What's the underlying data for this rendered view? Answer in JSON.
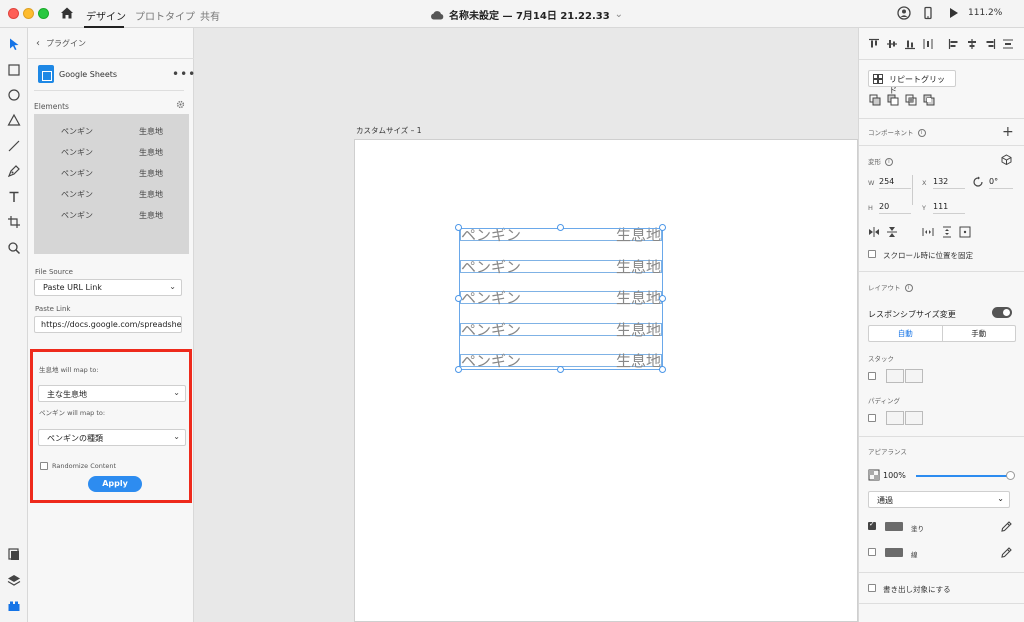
{
  "titlebar": {
    "tabs": [
      {
        "label": "デザイン"
      },
      {
        "label": "プロトタイプ"
      },
      {
        "label": "共有"
      }
    ],
    "document_title": "名称未設定 — 7月14日 21.22.33",
    "zoom": "111.2%"
  },
  "plugin": {
    "back_label": "プラグイン",
    "name": "Google Sheets",
    "elements_label": "Elements",
    "element_rows": [
      {
        "a": "ペンギン",
        "b": "生息地"
      },
      {
        "a": "ペンギン",
        "b": "生息地"
      },
      {
        "a": "ペンギン",
        "b": "生息地"
      },
      {
        "a": "ペンギン",
        "b": "生息地"
      },
      {
        "a": "ペンギン",
        "b": "生息地"
      }
    ],
    "file_source_label": "File Source",
    "file_source_value": "Paste URL Link",
    "paste_link_label": "Paste Link",
    "paste_link_value": "https://docs.google.com/spreadshe",
    "mapping": {
      "map1_label": "生息地 will map to:",
      "map1_value": "主な生息地",
      "map2_label": "ペンギン will map to:",
      "map2_value": "ペンギンの種類",
      "randomize_label": "Randomize Content",
      "apply_label": "Apply"
    }
  },
  "canvas": {
    "artboard_name": "カスタムサイズ – 1",
    "rows": [
      {
        "left": "ペンギン",
        "right": "生息地"
      },
      {
        "left": "ペンギン",
        "right": "生息地"
      },
      {
        "left": "ペンギン",
        "right": "生息地"
      },
      {
        "left": "ペンギン",
        "right": "生息地"
      },
      {
        "left": "ペンギン",
        "right": "生息地"
      }
    ]
  },
  "props": {
    "repeat_grid_label": "リピートグリッド",
    "component_label": "コンポーネント",
    "transform_label": "変形",
    "w_key": "W",
    "w_value": "254",
    "x_key": "X",
    "x_value": "132",
    "rotation_value": "0°",
    "h_key": "H",
    "h_value": "20",
    "y_key": "Y",
    "y_value": "111",
    "scroll_fix_label": "スクロール時に位置を固定",
    "layout_label": "レイアウト",
    "responsive_label": "レスポンシブサイズ変更",
    "auto_label": "自動",
    "manual_label": "手動",
    "stack_label": "スタック",
    "padding_label": "パディング",
    "appearance_label": "アピアランス",
    "opacity_value": "100%",
    "blend_value": "通過",
    "fill_label": "塗り",
    "border_label": "線",
    "export_label": "書き出し対象にする"
  }
}
